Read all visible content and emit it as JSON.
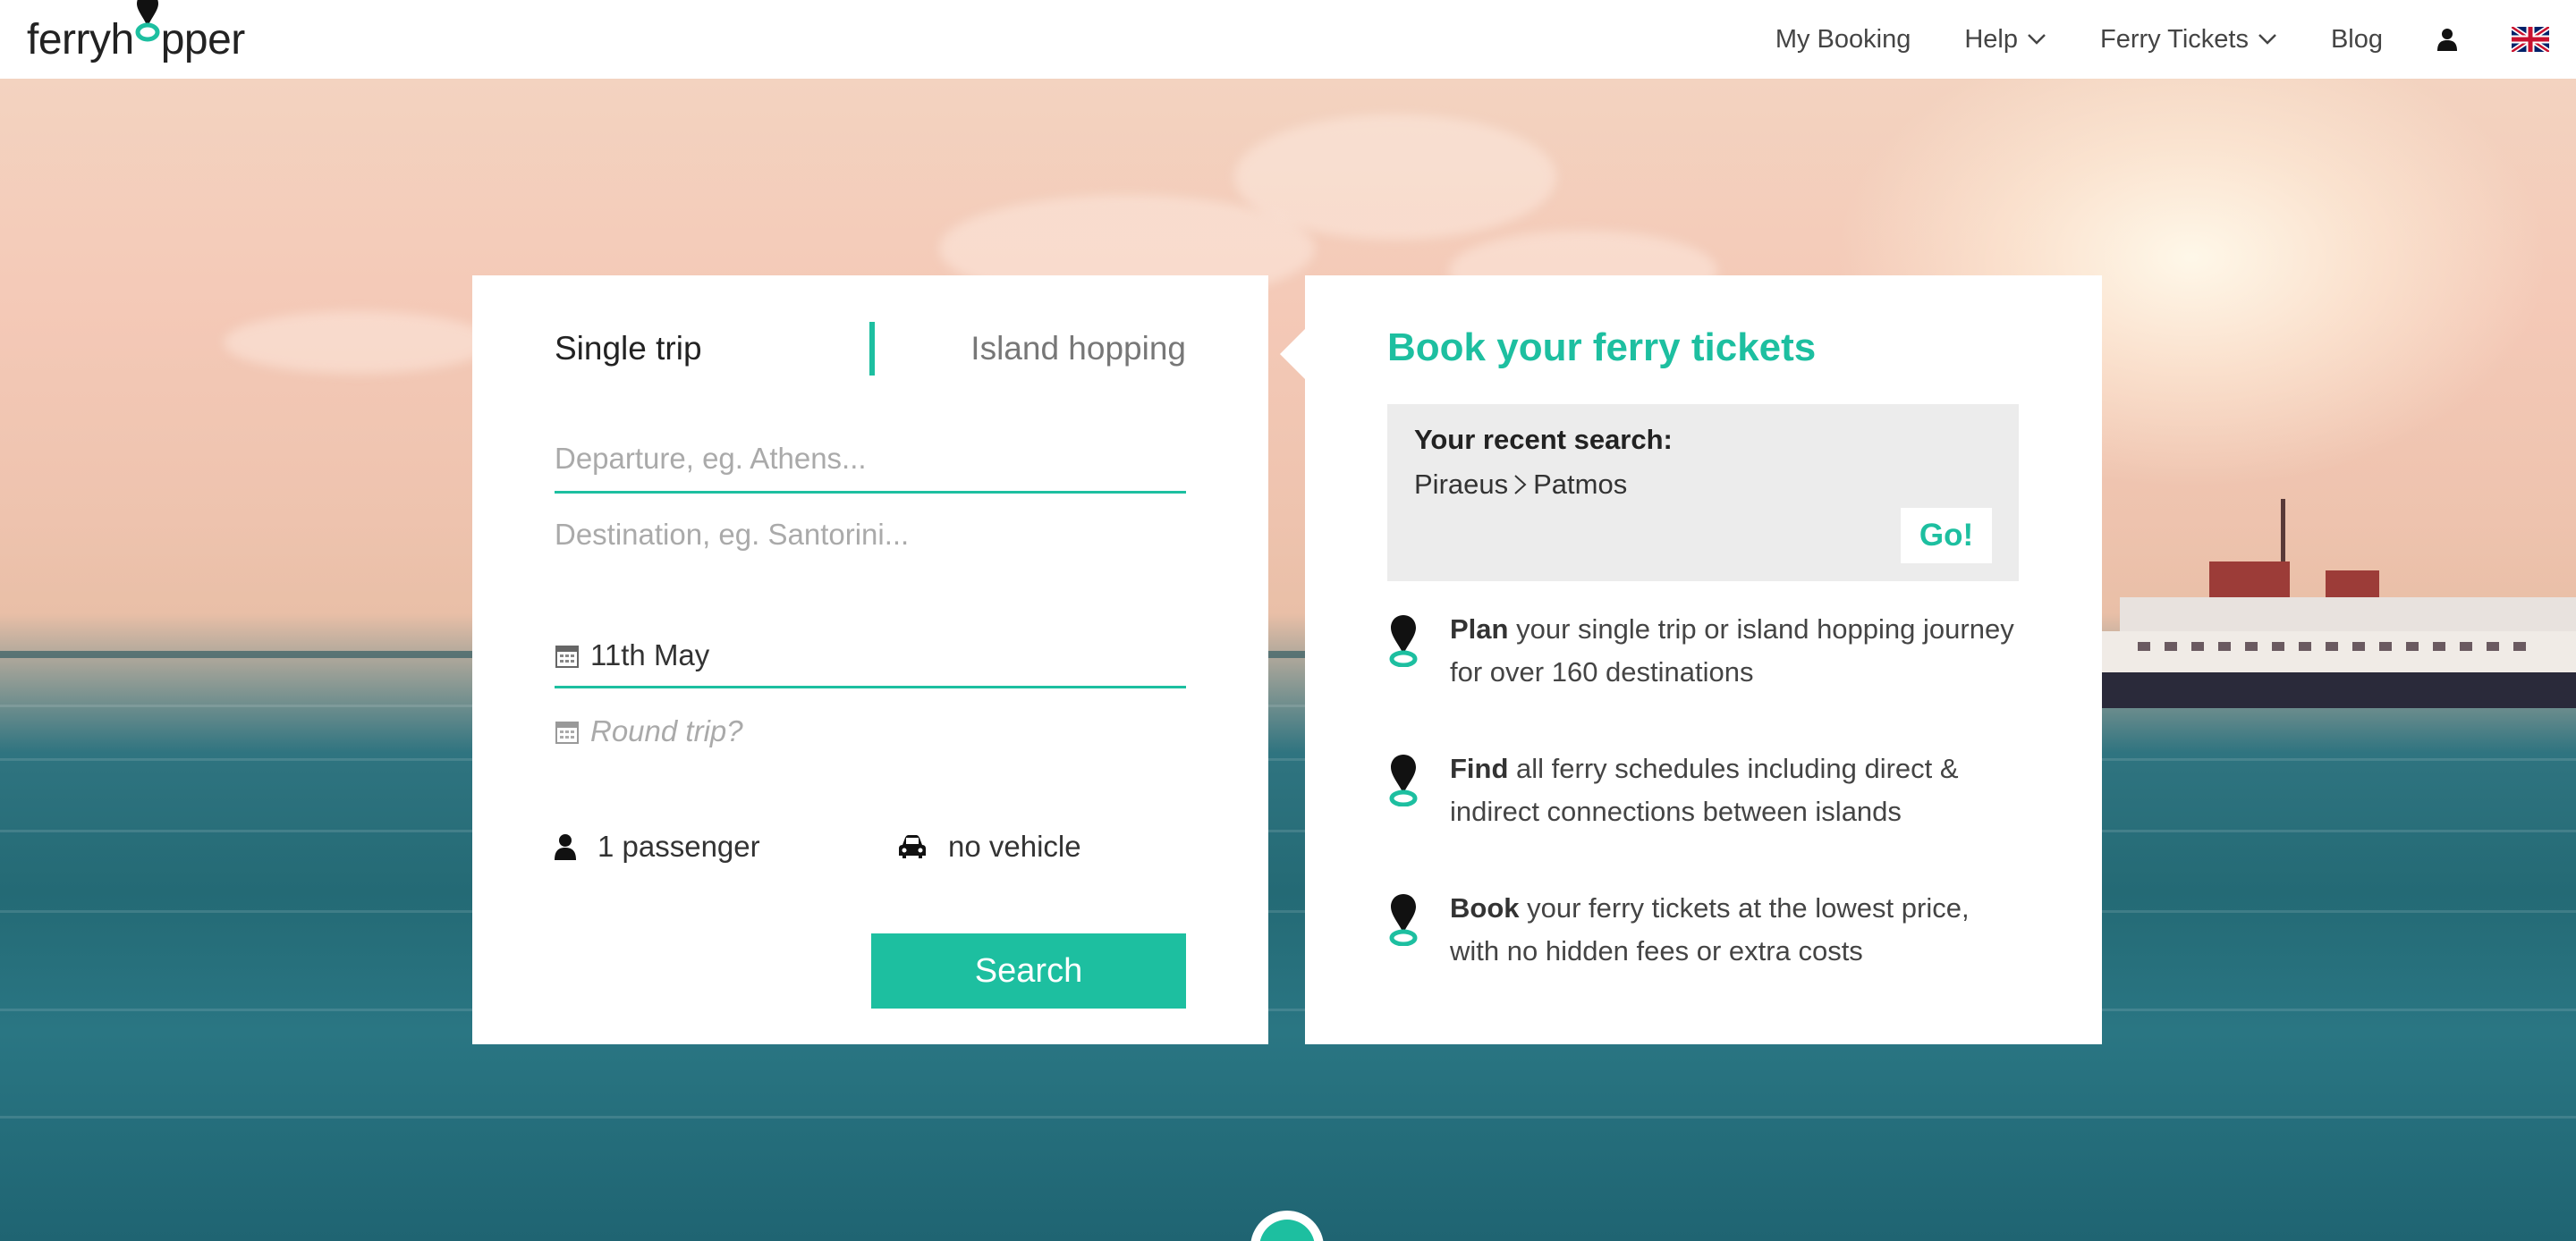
{
  "header": {
    "logo_left": "ferry",
    "logo_right": "pper",
    "logo_h": "h",
    "nav": {
      "my_booking": "My Booking",
      "help": "Help",
      "ferry_tickets": "Ferry Tickets",
      "blog": "Blog"
    }
  },
  "search": {
    "tab_single": "Single trip",
    "tab_island": "Island hopping",
    "departure_placeholder": "Departure, eg. Athens...",
    "destination_placeholder": "Destination, eg. Santorini...",
    "date": "11th May",
    "round_trip": "Round trip?",
    "passengers": "1 passenger",
    "vehicle": "no vehicle",
    "search_button": "Search"
  },
  "info": {
    "title": "Book your ferry tickets",
    "recent_label": "Your recent search:",
    "recent_from": "Piraeus",
    "recent_sep": ">",
    "recent_to": "Patmos",
    "go_button": "Go!",
    "features": [
      {
        "bold": "Plan",
        "text": " your single trip or island hopping journey for over 160 destinations"
      },
      {
        "bold": "Find",
        "text": " all ferry schedules including direct & indirect connections between islands"
      },
      {
        "bold": "Book",
        "text": " your ferry tickets at the lowest price, with no hidden fees or extra costs"
      }
    ]
  },
  "colors": {
    "accent": "#1dbfa0",
    "panel_gray": "#ececec"
  }
}
